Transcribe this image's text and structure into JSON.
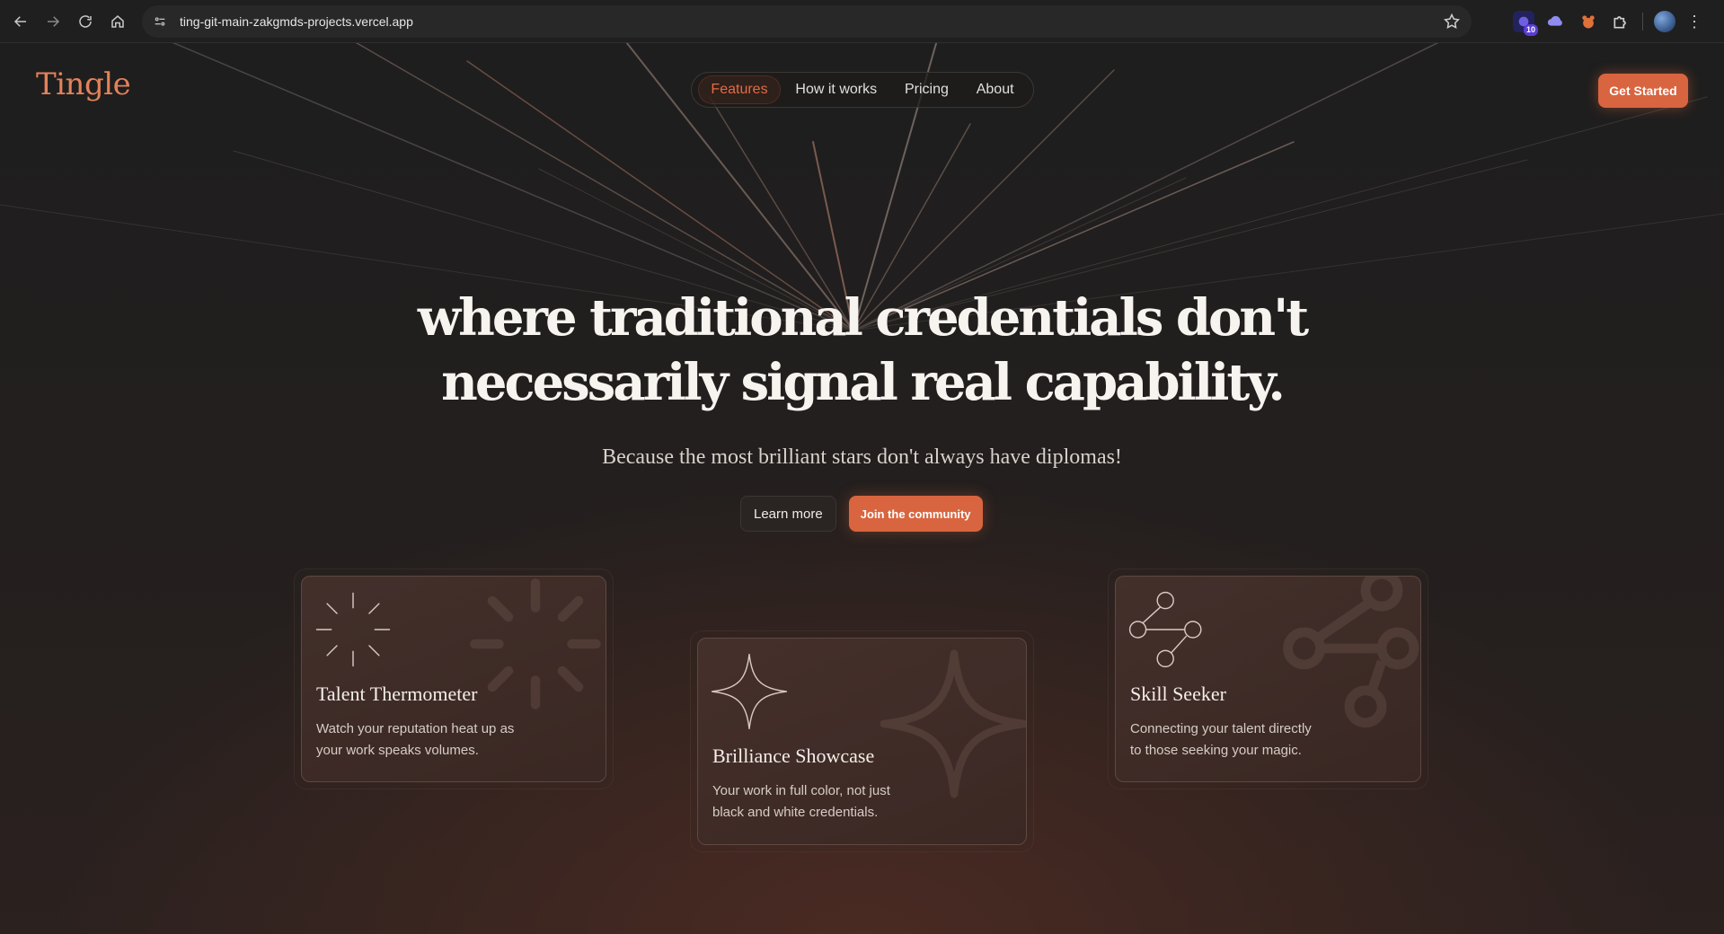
{
  "browser": {
    "url": "ting-git-main-zakgmds-projects.vercel.app",
    "extensions": [
      {
        "name": "extension-badge-icon",
        "badge": "10",
        "color": "#2a2a7a"
      },
      {
        "name": "cloud-icon",
        "color": "#8e8cf0"
      },
      {
        "name": "bear-icon",
        "color": "#e0703a"
      },
      {
        "name": "puzzle-icon",
        "color": "#d0d0d0"
      }
    ]
  },
  "site": {
    "logo": "Tingle",
    "nav": [
      {
        "label": "Features",
        "active": true
      },
      {
        "label": "How it works",
        "active": false
      },
      {
        "label": "Pricing",
        "active": false
      },
      {
        "label": "About",
        "active": false
      }
    ],
    "get_started": "Get Started"
  },
  "hero": {
    "title_line1": "where traditional credentials don't",
    "title_line2": "necessarily signal real capability.",
    "subtitle": "Because the most brilliant stars don't always have diplomas!",
    "learn_more": "Learn more",
    "join": "Join the community"
  },
  "features": [
    {
      "icon": "sparkle-burst-icon",
      "title": "Talent Thermometer",
      "text_line1": "Watch your reputation heat up as",
      "text_line2": "your work speaks volumes."
    },
    {
      "icon": "four-point-star-icon",
      "title": "Brilliance Showcase",
      "text_line1": "Your work in full color, not just",
      "text_line2": "black and white credentials."
    },
    {
      "icon": "share-network-icon",
      "title": "Skill Seeker",
      "text_line1": "Connecting your talent directly",
      "text_line2": "to those seeking your magic."
    }
  ],
  "colors": {
    "accent": "#d8653f",
    "logo": "#e3825a",
    "nav_active": "#e36b42",
    "background": "#1c1c1c"
  }
}
